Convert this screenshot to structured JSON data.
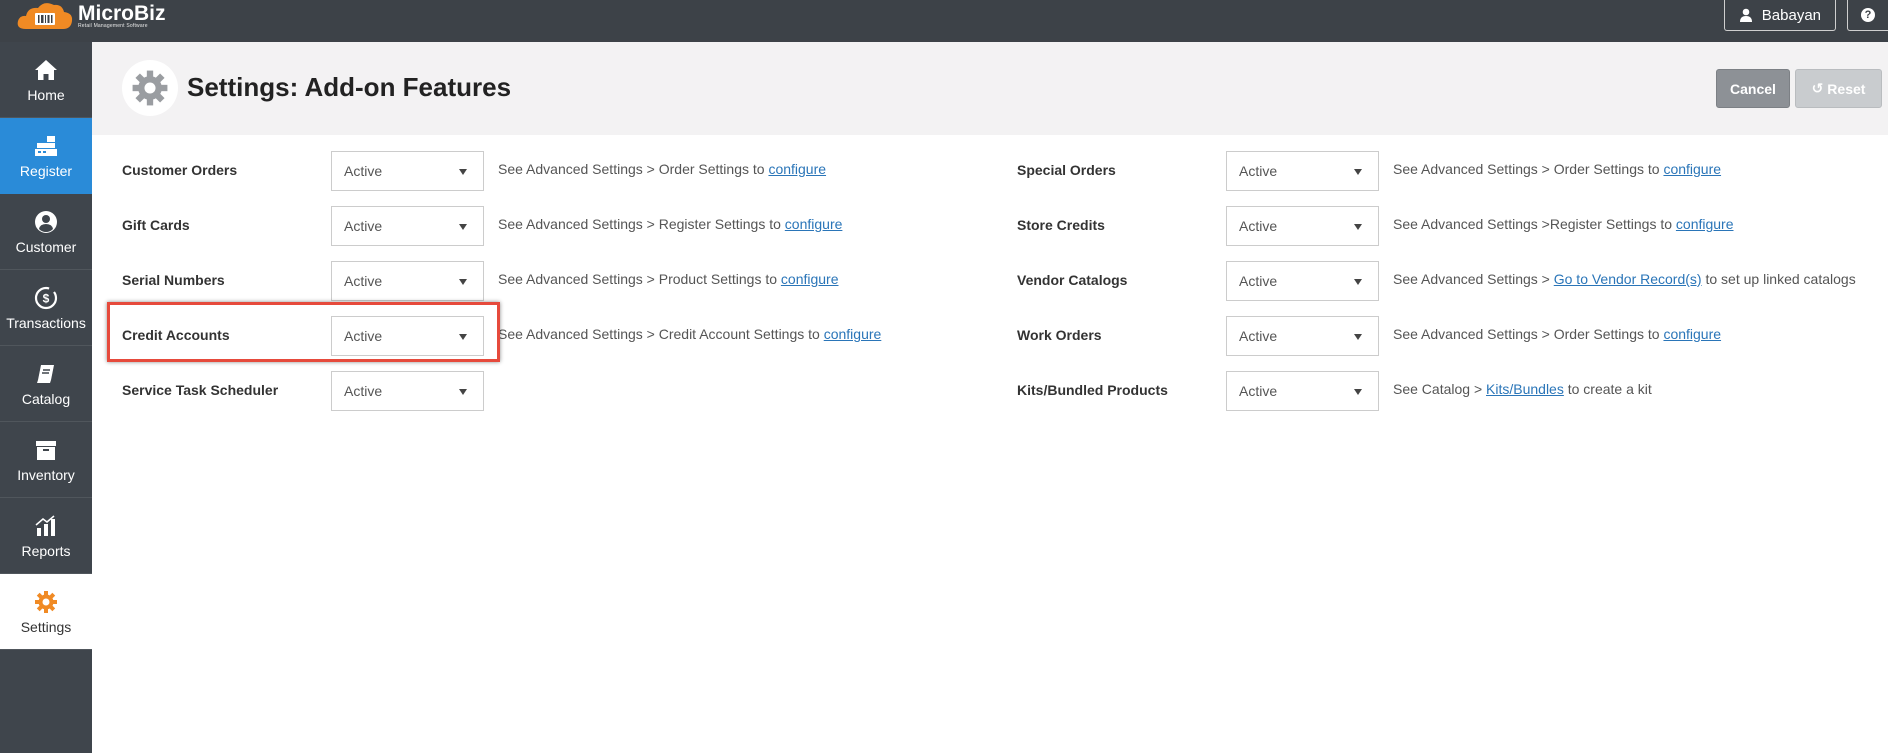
{
  "app": {
    "logo_name": "MicroBiz",
    "logo_tagline": "Retail Management Software",
    "user_name": "Babayan",
    "help_label": "?",
    "brand_color": "#f08a24",
    "topbar_color": "#3d4248",
    "sidebar_active_color": "#2a8bd8"
  },
  "sidebar": {
    "items": [
      {
        "label": "Home",
        "icon": "home-icon"
      },
      {
        "label": "Register",
        "icon": "register-icon"
      },
      {
        "label": "Customer",
        "icon": "customer-icon"
      },
      {
        "label": "Transactions",
        "icon": "transactions-icon"
      },
      {
        "label": "Catalog",
        "icon": "catalog-icon"
      },
      {
        "label": "Inventory",
        "icon": "inventory-icon"
      },
      {
        "label": "Reports",
        "icon": "reports-icon"
      },
      {
        "label": "Settings",
        "icon": "gear-icon"
      }
    ]
  },
  "header": {
    "title": "Settings: Add-on Features",
    "cancel_label": "Cancel",
    "reset_label": "Reset"
  },
  "features": {
    "left": [
      {
        "label": "Customer Orders",
        "value": "Active",
        "desc_before": "See Advanced Settings > Order Settings to",
        "link": "configure",
        "desc_after": ""
      },
      {
        "label": "Gift Cards",
        "value": "Active",
        "desc_before": "See Advanced Settings > Register Settings to",
        "link": "configure",
        "desc_after": ""
      },
      {
        "label": "Serial Numbers",
        "value": "Active",
        "desc_before": "See Advanced Settings > Product Settings to",
        "link": "configure",
        "desc_after": ""
      },
      {
        "label": "Credit Accounts",
        "value": "Active",
        "desc_before": "See Advanced Settings > Credit Account Settings to",
        "link": "configure",
        "desc_after": ""
      },
      {
        "label": "Service Task Scheduler",
        "value": "Active",
        "desc_before": "",
        "link": "",
        "desc_after": ""
      }
    ],
    "right": [
      {
        "label": "Special Orders",
        "value": "Active",
        "desc_before": "See Advanced Settings > Order Settings to",
        "link": "configure",
        "desc_after": ""
      },
      {
        "label": "Store Credits",
        "value": "Active",
        "desc_before": "See Advanced Settings >Register Settings to",
        "link": "configure",
        "desc_after": ""
      },
      {
        "label": "Vendor Catalogs",
        "value": "Active",
        "desc_before": "See Advanced Settings >",
        "link": "Go to Vendor Record(s)",
        "desc_after": "to set up linked catalogs"
      },
      {
        "label": "Work Orders",
        "value": "Active",
        "desc_before": "See Advanced Settings > Order Settings to",
        "link": "configure",
        "desc_after": ""
      },
      {
        "label": "Kits/Bundled Products",
        "value": "Active",
        "desc_before": "See Catalog >",
        "link": "Kits/Bundles",
        "desc_after": "to create a kit"
      }
    ]
  }
}
